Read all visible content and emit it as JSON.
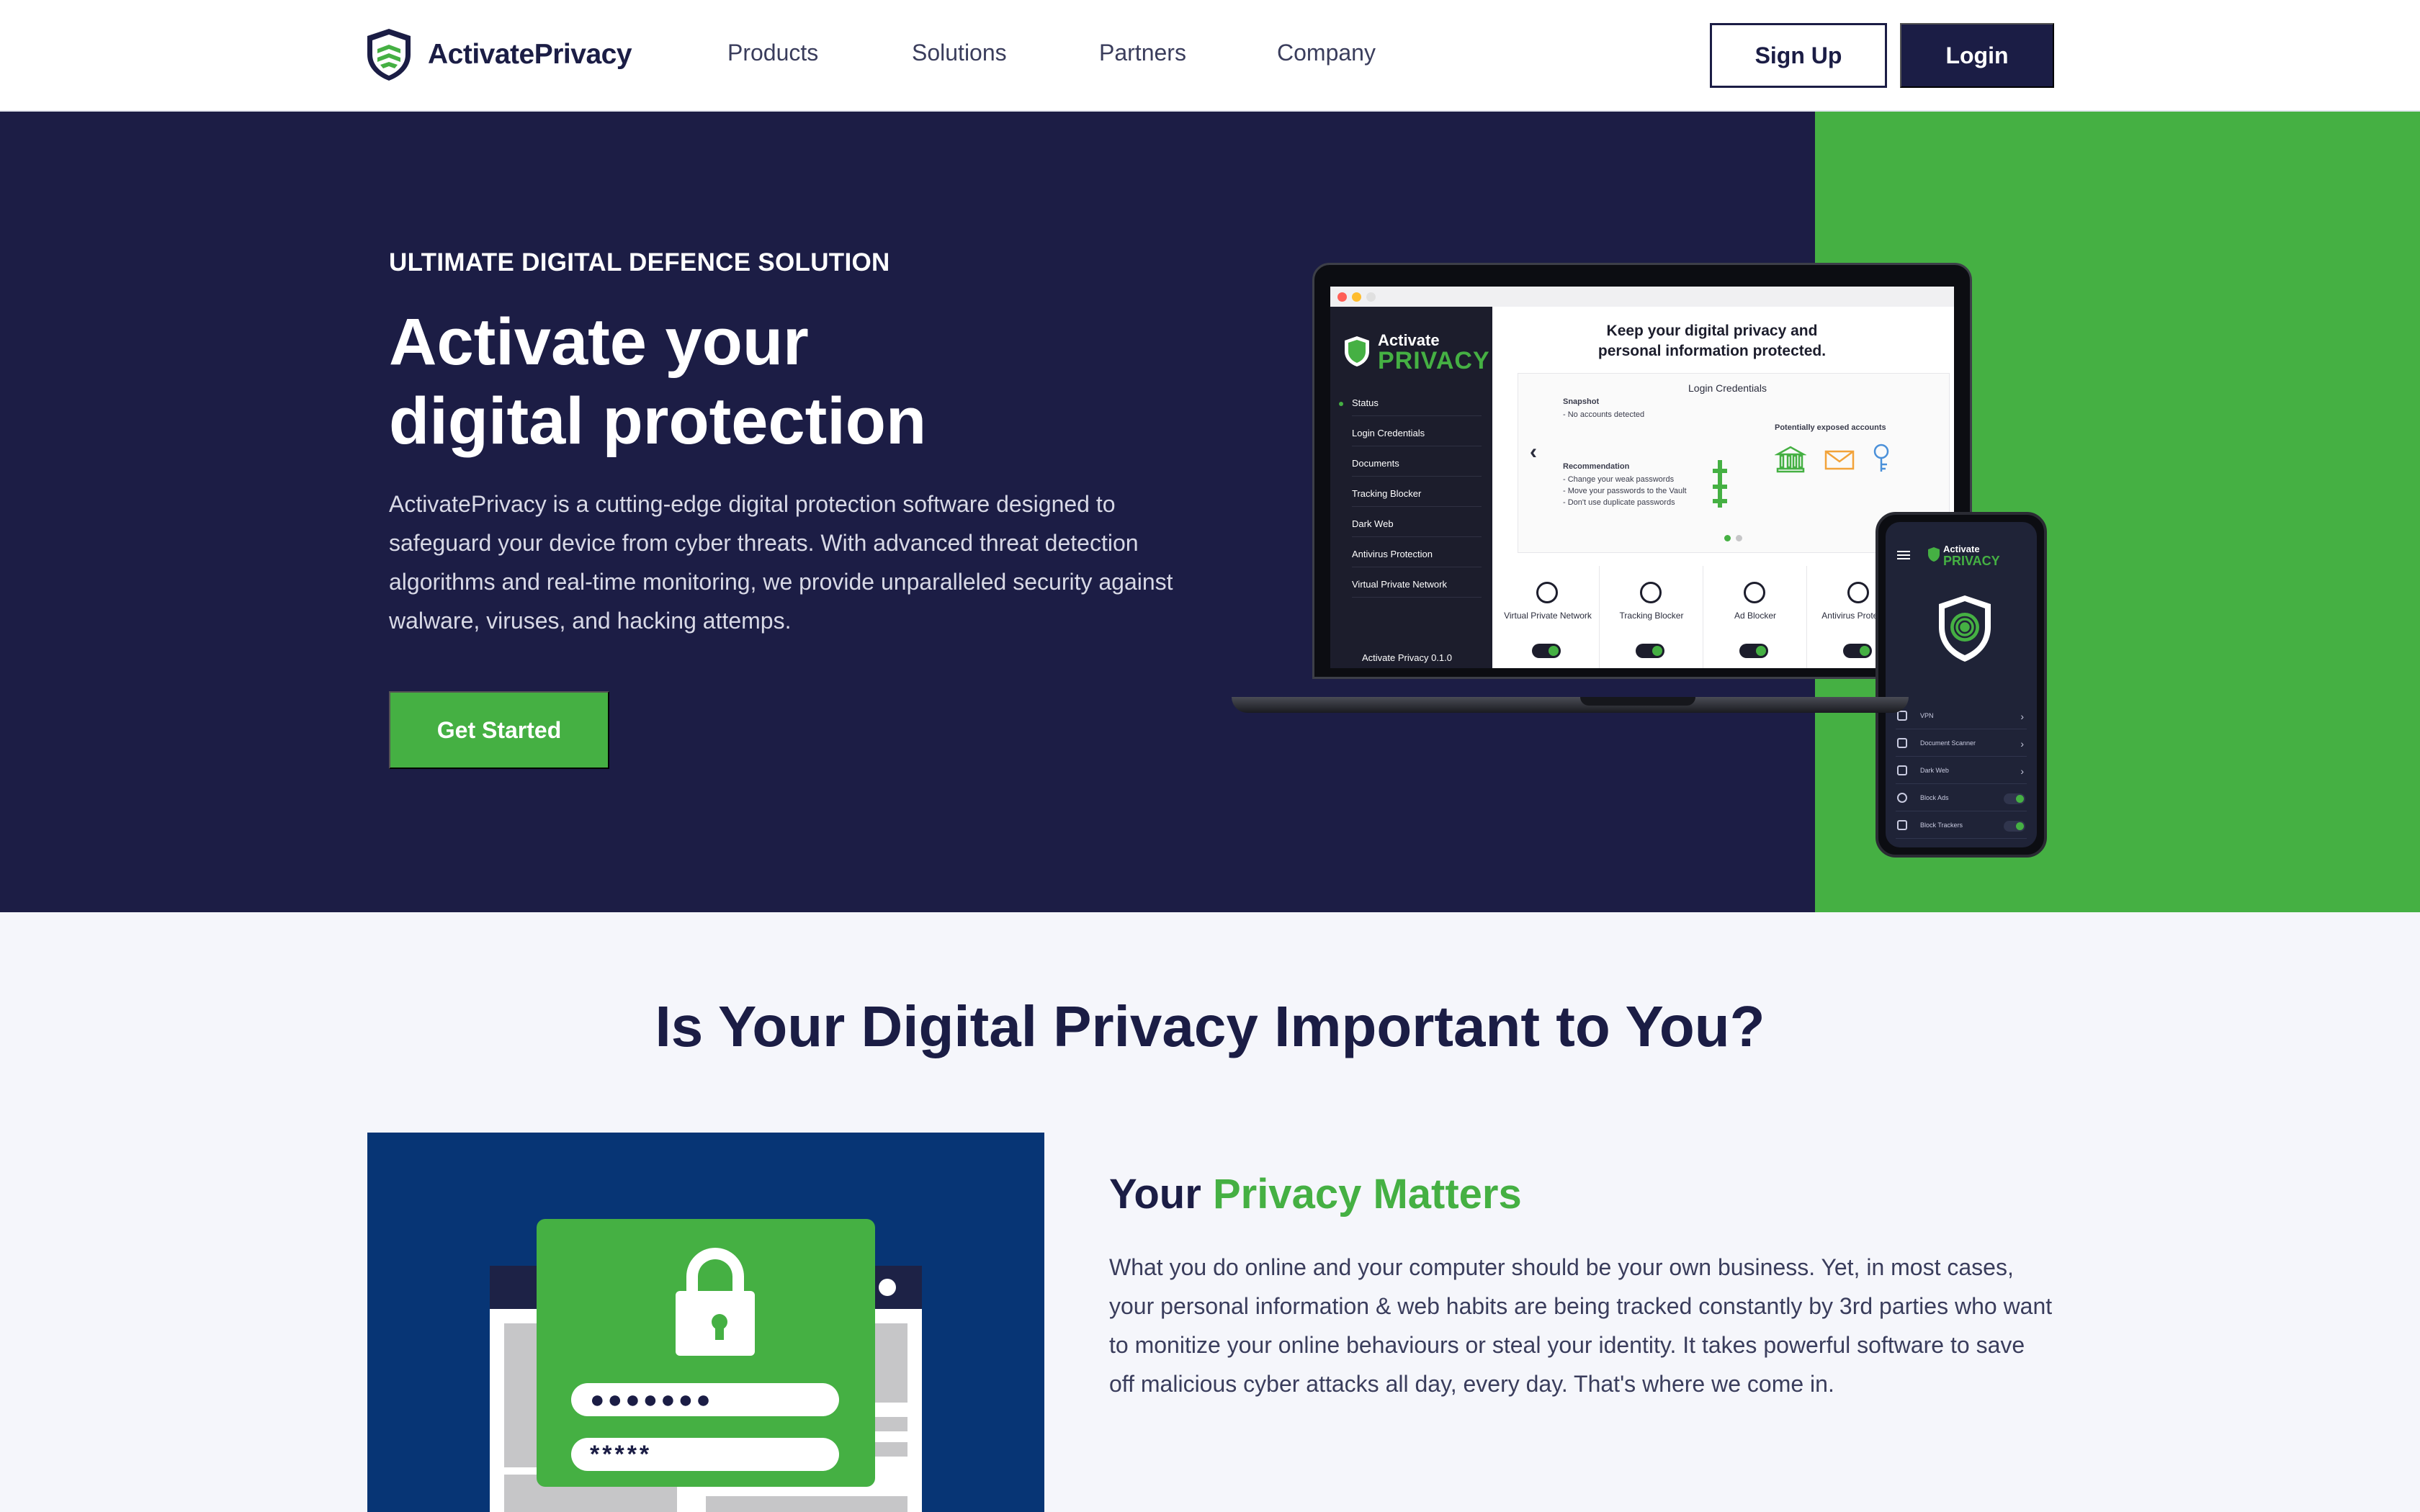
{
  "nav": {
    "brand": "ActivatePrivacy",
    "links": [
      "Products",
      "Solutions",
      "Partners",
      "Company"
    ],
    "signup_label": "Sign Up",
    "login_label": "Login"
  },
  "hero": {
    "eyebrow": "ULTIMATE DIGITAL DEFENCE SOLUTION",
    "title_line1": "Activate your",
    "title_line2": "digital protection",
    "description": "ActivatePrivacy is a cutting-edge digital protection software designed to safeguard your device from cyber threats. With advanced threat detection algorithms and real-time monitoring, we provide unparalleled security against walware, viruses, and hacking attemps.",
    "cta_label": "Get Started"
  },
  "app_mockup": {
    "logo_top": "Activate",
    "logo_bottom": "PRIVACY",
    "sidebar": [
      "Status",
      "Login Credentials",
      "Documents",
      "Tracking Blocker",
      "Dark Web",
      "Antivirus Protection",
      "Virtual Private Network"
    ],
    "version": "Activate Privacy 0.1.0",
    "headline_1": "Keep your digital privacy and",
    "headline_2": "personal information protected.",
    "card_title": "Login Credentials",
    "snapshot_label": "Snapshot",
    "snapshot_value": "- No accounts detected",
    "exposed_label": "Potentially exposed accounts",
    "recommendation_label": "Recommendation",
    "recommendation_1": "- Change your weak passwords",
    "recommendation_2": "- Move your passwords to the Vault",
    "recommendation_3": "- Don't use duplicate passwords",
    "tiles": [
      "Virtual Private Network",
      "Tracking Blocker",
      "Ad Blocker",
      "Antivirus Protection"
    ],
    "chevron_left": "‹"
  },
  "phone_mockup": {
    "logo_top": "Activate",
    "logo_bottom": "PRIVACY",
    "rows": [
      "VPN",
      "Document Scanner",
      "Dark Web",
      "Block Ads",
      "Block Trackers"
    ]
  },
  "privacy_section": {
    "title": "Is Your Digital Privacy Important to You?",
    "subtitle_prefix": "Your ",
    "subtitle_highlight": "Privacy Matters",
    "description": "What you do online and your computer should be your own business. Yet, in most cases, your personal information & web habits are being tracked constantly by 3rd parties who want to monitize your online behaviours or steal your identity. It takes powerful software to save off malicious cyber attacks all day, every day. That's where we come in.",
    "password_dots": "●●●●●●●",
    "password_stars": "*****"
  },
  "colors": {
    "navy": "#1c1d45",
    "green": "#45b043",
    "illustration_blue": "#073575"
  }
}
